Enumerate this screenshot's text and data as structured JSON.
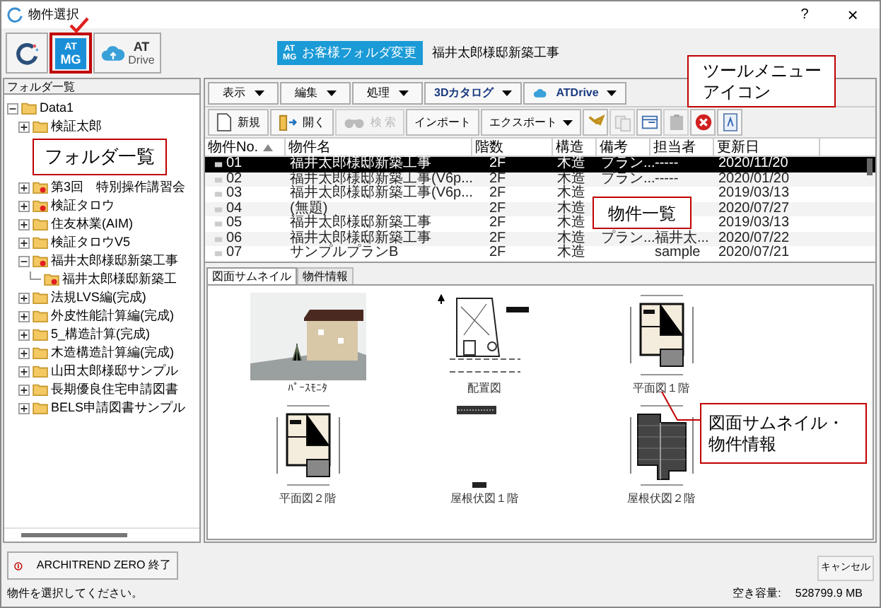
{
  "window": {
    "title": "物件選択",
    "help": "?",
    "close": "×"
  },
  "app_bar": {
    "apps": [
      {
        "kind": "ring",
        "selected": false
      },
      {
        "kind": "logo",
        "lines": [
          "AT",
          "MG"
        ],
        "selected": true
      },
      {
        "kind": "cloud",
        "lines": [
          "AT",
          "Drive"
        ],
        "selected": false
      }
    ],
    "folder_button": {
      "logo": [
        "AT",
        "MG"
      ],
      "label": "お客様フォルダ変更"
    },
    "current_folder": "福井太郎様邸新築工事"
  },
  "folder_panel": {
    "title": "フォルダ一覧",
    "callout": "フォルダ一覧",
    "tree": [
      {
        "label": "Data1",
        "expanded": true,
        "marked": false,
        "children": [
          {
            "label": "検証太郎",
            "expanded": false,
            "marked": false
          },
          {
            "label": "第3回　特別操作講習会",
            "expanded": false,
            "marked": true
          },
          {
            "label": "検証タロウ",
            "expanded": false,
            "marked": true
          },
          {
            "label": "住友林業(AIM)",
            "expanded": false,
            "marked": false
          },
          {
            "label": "検証タロウV5",
            "expanded": false,
            "marked": false
          },
          {
            "label": "福井太郎様邸新築工事",
            "expanded": true,
            "marked": true,
            "children": [
              {
                "label": "福井太郎様邸新築工",
                "marked": true
              }
            ]
          },
          {
            "label": "法規LVS編(完成)",
            "expanded": false,
            "marked": false
          },
          {
            "label": "外皮性能計算編(完成)",
            "expanded": false,
            "marked": false
          },
          {
            "label": "5_構造計算(完成)",
            "expanded": false,
            "marked": false
          },
          {
            "label": "木造構造計算編(完成)",
            "expanded": false,
            "marked": false
          },
          {
            "label": "山田太郎様邸サンプル",
            "expanded": false,
            "marked": false
          },
          {
            "label": "長期優良住宅申請図書",
            "expanded": false,
            "marked": false
          },
          {
            "label": "BELS申請図書サンプル",
            "expanded": false,
            "marked": false
          }
        ]
      }
    ]
  },
  "menus": [
    {
      "label": "表示",
      "kind": "plain"
    },
    {
      "label": "編集",
      "kind": "plain"
    },
    {
      "label": "処理",
      "kind": "plain"
    },
    {
      "label": "3Dカタログ",
      "kind": "catalog"
    },
    {
      "label": "ATDrive",
      "kind": "cloud"
    }
  ],
  "toolbar": [
    {
      "kind": "page",
      "label": "新規",
      "disabled": false
    },
    {
      "kind": "open",
      "label": "開く",
      "disabled": false
    },
    {
      "kind": "binoculars",
      "label": "検 索",
      "disabled": true
    },
    {
      "kind": "text",
      "label": "インポート",
      "disabled": false
    },
    {
      "kind": "dropdown",
      "label": "エクスポート",
      "disabled": false
    },
    {
      "kind": "tool",
      "disabled": false
    },
    {
      "kind": "copy",
      "disabled": true
    },
    {
      "kind": "window",
      "disabled": false
    },
    {
      "kind": "clipboard",
      "disabled": true
    },
    {
      "kind": "delete",
      "disabled": false
    },
    {
      "kind": "document",
      "disabled": false
    }
  ],
  "toolbar_callout": [
    "ツールメニュー",
    "アイコン"
  ],
  "table": {
    "columns": [
      {
        "label": "物件No.",
        "sorted": true
      },
      {
        "label": "物件名",
        "sorted": false
      },
      {
        "label": "階数",
        "sorted": false
      },
      {
        "label": "構造",
        "sorted": false
      },
      {
        "label": "備考",
        "sorted": false
      },
      {
        "label": "担当者",
        "sorted": false
      },
      {
        "label": "更新日",
        "sorted": false
      }
    ],
    "rows": [
      {
        "selected": true,
        "cells": [
          "01",
          "福井太郎様邸新築工事",
          "2F",
          "木造",
          "プラン...",
          "-----",
          "2020/11/20"
        ]
      },
      {
        "selected": false,
        "cells": [
          "02",
          "福井太郎様邸新築工事(V6p...",
          "2F",
          "木造",
          "プラン...",
          "-----",
          "2020/01/20"
        ]
      },
      {
        "selected": false,
        "cells": [
          "03",
          "福井太郎様邸新築工事(V6p...",
          "2F",
          "木造",
          "",
          "",
          "2019/03/13"
        ]
      },
      {
        "selected": false,
        "cells": [
          "04",
          "(無題)",
          "2F",
          "木造",
          "",
          "",
          "2020/07/27"
        ]
      },
      {
        "selected": false,
        "cells": [
          "05",
          "福井太郎様邸新築工事",
          "2F",
          "木造",
          "",
          "",
          "2019/03/13"
        ]
      },
      {
        "selected": false,
        "cells": [
          "06",
          "福井太郎様邸新築工事",
          "2F",
          "木造",
          "プラン...",
          "福井太...",
          "2020/07/22"
        ]
      },
      {
        "selected": false,
        "cells": [
          "07",
          "サンプルプランB",
          "2F",
          "木造",
          "",
          "sample",
          "2020/07/21"
        ]
      }
    ],
    "callout": "物件一覧"
  },
  "tabs": [
    {
      "label": "図面サムネイル",
      "selected": true
    },
    {
      "label": "物件情報",
      "selected": false
    }
  ],
  "thumbnails": [
    {
      "kind": "perspective",
      "label": "ﾊﾟｰｽﾓﾆﾀ"
    },
    {
      "kind": "site",
      "label": "配置図"
    },
    {
      "kind": "floor",
      "label": "平面図１階"
    },
    {
      "kind": "floor",
      "label": "平面図２階"
    },
    {
      "kind": "roof-partial",
      "label": "屋根伏図１階"
    },
    {
      "kind": "roof",
      "label": "屋根伏図２階"
    }
  ],
  "thumbnail_callout": [
    "図面サムネイル・",
    "物件情報"
  ],
  "exit_button": "ARCHITREND ZERO 終了",
  "cancel_button": "キャンセル",
  "status_text": "物件を選択してください。",
  "free_space": {
    "label": "空き容量:",
    "value": "528799.9 MB"
  }
}
